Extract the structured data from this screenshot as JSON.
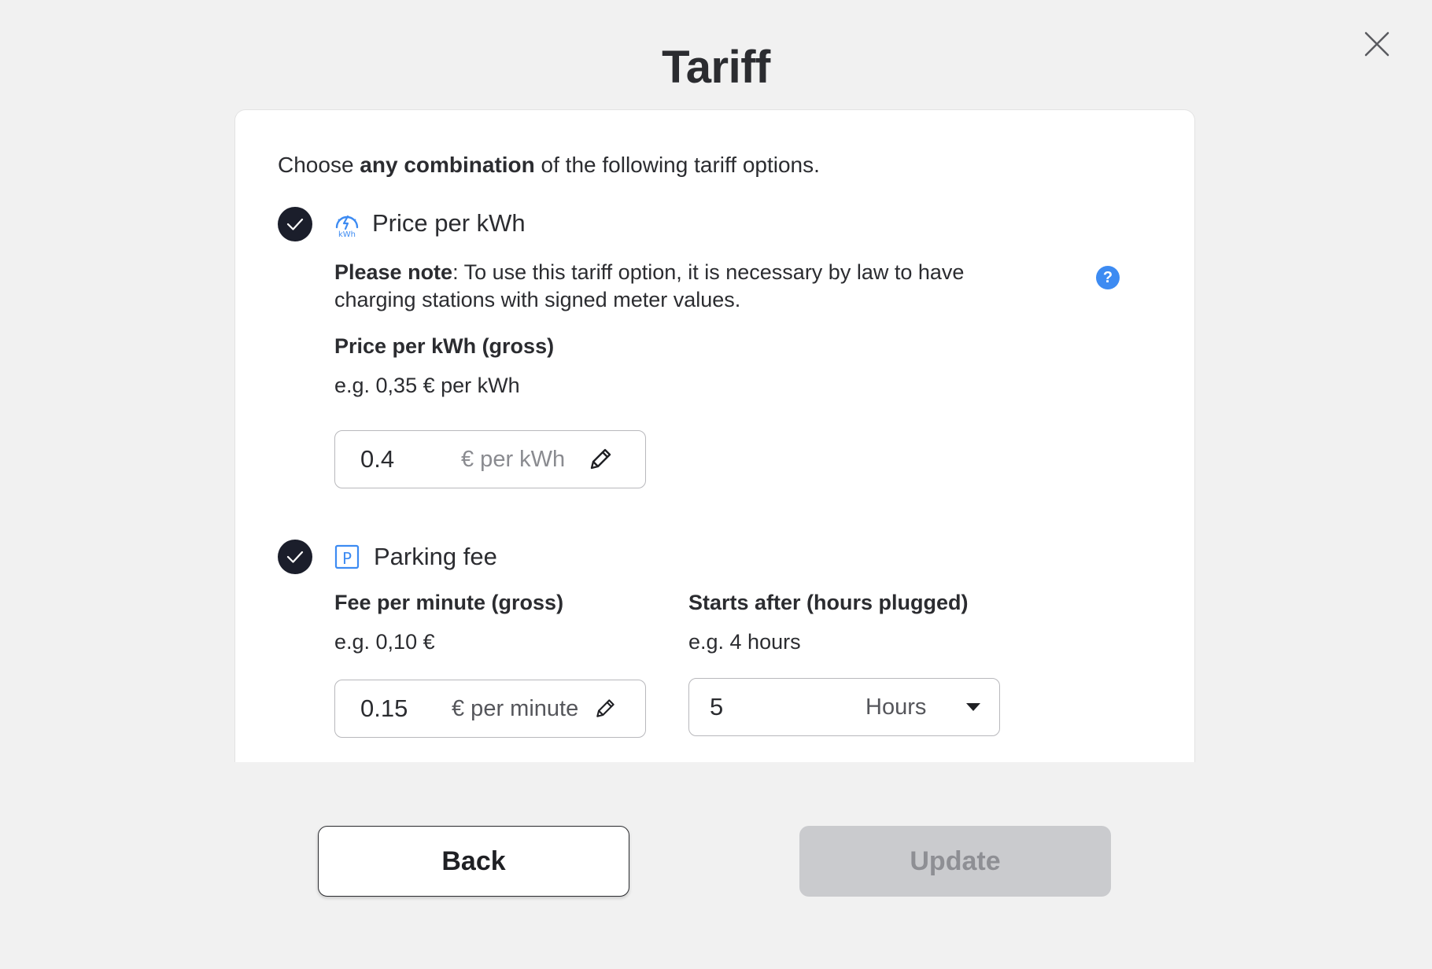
{
  "dialog": {
    "title": "Tariff"
  },
  "intro": {
    "prefix": "Choose ",
    "bold": "any combination",
    "suffix": " of the following tariff options."
  },
  "price_per_kwh": {
    "checked": true,
    "title": "Price per kWh",
    "icon_text": "kWh",
    "note_bold": "Please note",
    "note_text": ": To use this tariff option, it is necessary by law to have charging stations with signed meter values.",
    "help_glyph": "?",
    "field_label": "Price per kWh (gross)",
    "field_hint": "e.g. 0,35 € per kWh",
    "value": "0.4",
    "unit": "€ per kWh"
  },
  "parking_fee": {
    "checked": true,
    "title": "Parking fee",
    "icon_text": "P",
    "fee": {
      "label": "Fee per minute (gross)",
      "hint": "e.g. 0,10 €",
      "value": "0.15",
      "unit": "€ per minute"
    },
    "starts_after": {
      "label": "Starts after (hours plugged)",
      "hint": "e.g. 4 hours",
      "value": "5",
      "unit": "Hours"
    }
  },
  "buttons": {
    "back": "Back",
    "update": "Update"
  },
  "colors": {
    "accent_blue": "#3d8bf2",
    "check_bg": "#1b1e2b",
    "update_disabled_bg": "#cacbce"
  }
}
